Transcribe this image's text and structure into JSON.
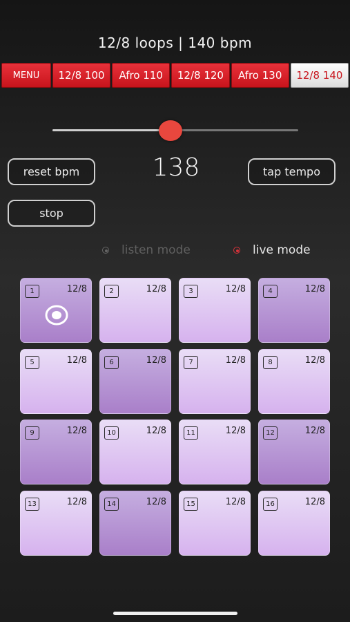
{
  "header": {
    "title": "12/8 loops | 140 bpm"
  },
  "tabs": [
    {
      "label": "MENU"
    },
    {
      "label": "12/8 100"
    },
    {
      "label": "Afro 110"
    },
    {
      "label": "12/8 120"
    },
    {
      "label": "Afro 130"
    },
    {
      "label": "12/8 140",
      "active": true
    }
  ],
  "tempo": {
    "slider_value_fraction": 0.48,
    "bpm": "138"
  },
  "buttons": {
    "reset_bpm": "reset bpm",
    "tap_tempo": "tap tempo",
    "stop": "stop"
  },
  "modes": {
    "listen": "listen mode",
    "live": "live mode",
    "selected": "live"
  },
  "pads": [
    {
      "number": "1",
      "sig": "12/8",
      "shade": "dark",
      "playing": true
    },
    {
      "number": "2",
      "sig": "12/8",
      "shade": "light"
    },
    {
      "number": "3",
      "sig": "12/8",
      "shade": "light"
    },
    {
      "number": "4",
      "sig": "12/8",
      "shade": "dark"
    },
    {
      "number": "5",
      "sig": "12/8",
      "shade": "light"
    },
    {
      "number": "6",
      "sig": "12/8",
      "shade": "dark"
    },
    {
      "number": "7",
      "sig": "12/8",
      "shade": "light"
    },
    {
      "number": "8",
      "sig": "12/8",
      "shade": "light"
    },
    {
      "number": "9",
      "sig": "12/8",
      "shade": "dark"
    },
    {
      "number": "10",
      "sig": "12/8",
      "shade": "light"
    },
    {
      "number": "11",
      "sig": "12/8",
      "shade": "light"
    },
    {
      "number": "12",
      "sig": "12/8",
      "shade": "dark"
    },
    {
      "number": "13",
      "sig": "12/8",
      "shade": "light"
    },
    {
      "number": "14",
      "sig": "12/8",
      "shade": "dark"
    },
    {
      "number": "15",
      "sig": "12/8",
      "shade": "light"
    },
    {
      "number": "16",
      "sig": "12/8",
      "shade": "light"
    }
  ],
  "colors": {
    "accent_red": "#c8141c",
    "thumb": "#e8473e",
    "pad_light": "#e0c8f2",
    "pad_dark": "#b894d6"
  }
}
